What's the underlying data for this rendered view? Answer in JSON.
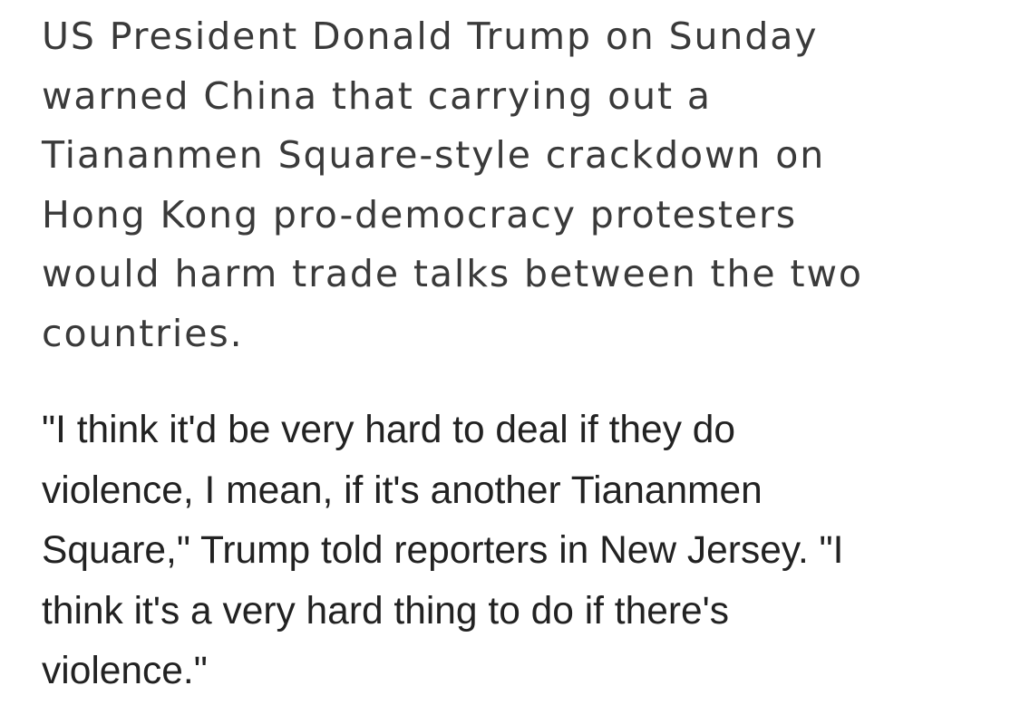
{
  "article": {
    "lead_lines": [
      "US President Donald Trump on Sunday",
      "warned China that carrying out a",
      "Tiananmen Square-style crackdown on",
      "Hong Kong pro-democracy protesters",
      "would harm trade talks between the two",
      "countries."
    ],
    "quote_lines": [
      "\"I think it'd be very hard to deal if they do",
      "violence, I mean, if it's another Tiananmen",
      "Square,\" Trump told reporters in New Jersey. \"I",
      "think it's a very hard thing to do if there's",
      "violence.\""
    ]
  },
  "colors": {
    "lead_text": "#3a3a3a",
    "quote_text": "#222222",
    "background": "#ffffff"
  }
}
